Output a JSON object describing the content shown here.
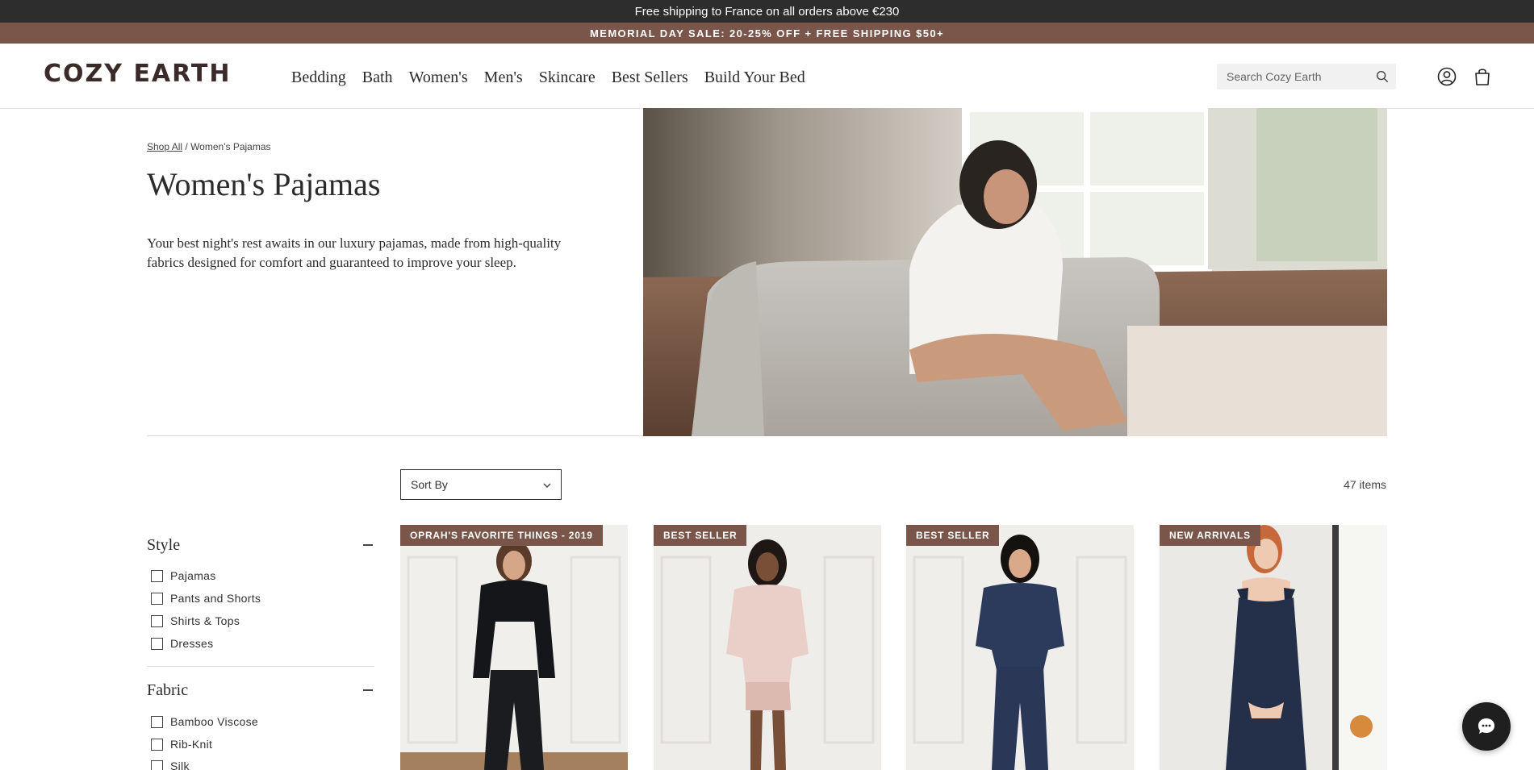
{
  "announcement": {
    "text": "Free shipping to France on all orders above €230"
  },
  "sale_banner": {
    "text": "MEMORIAL DAY SALE: 20-25% OFF + FREE SHIPPING $50+"
  },
  "header": {
    "logo": "COZY EARTH",
    "nav": [
      "Bedding",
      "Bath",
      "Women's",
      "Men's",
      "Skincare",
      "Best Sellers",
      "Build Your Bed"
    ],
    "search_placeholder": "Search Cozy Earth",
    "icons": {
      "search": "search-icon",
      "account": "account-icon",
      "cart": "bag-icon"
    }
  },
  "breadcrumb": {
    "root": "Shop All",
    "separator": " / ",
    "current": "Women's Pajamas"
  },
  "collection": {
    "title": "Women's Pajamas",
    "description": "Your best night's rest awaits in our luxury pajamas, made from high-quality fabrics designed for comfort and guaranteed to improve your sleep."
  },
  "toolbar": {
    "sort_label": "Sort By",
    "item_count": "47 items"
  },
  "filters": {
    "style": {
      "title": "Style",
      "options": [
        "Pajamas",
        "Pants and Shorts",
        "Shirts & Tops",
        "Dresses"
      ]
    },
    "fabric": {
      "title": "Fabric",
      "options": [
        "Bamboo Viscose",
        "Rib-Knit",
        "Silk"
      ]
    }
  },
  "products": [
    {
      "badge": "OPRAH'S FAVORITE THINGS - 2019"
    },
    {
      "badge": "BEST SELLER"
    },
    {
      "badge": "BEST SELLER"
    },
    {
      "badge": "NEW ARRIVALS"
    }
  ],
  "colors": {
    "brand_brown": "#7a564a",
    "topbar": "#2d2d2d",
    "navy": "#2c3a5c"
  }
}
